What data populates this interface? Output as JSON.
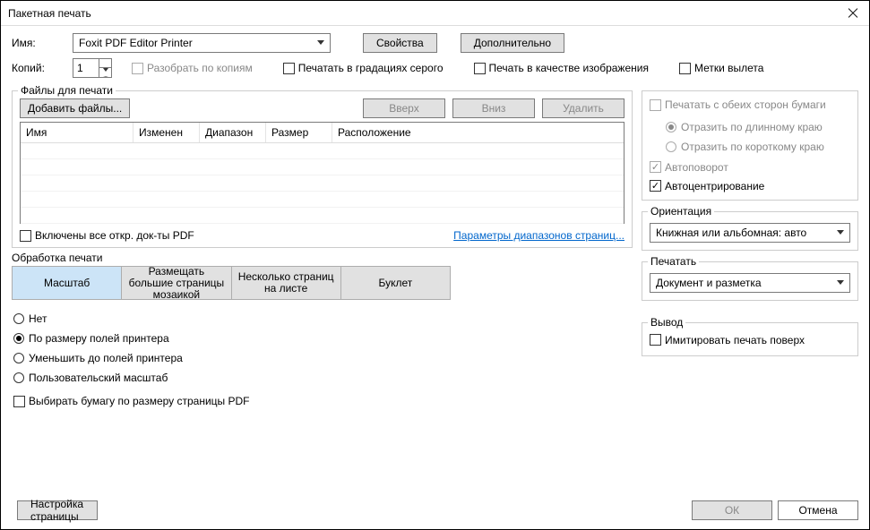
{
  "window": {
    "title": "Пакетная печать"
  },
  "printer": {
    "name_label": "Имя:",
    "name_value": "Foxit PDF Editor Printer",
    "properties_btn": "Свойства",
    "advanced_btn": "Дополнительно",
    "copies_label": "Копий:",
    "copies_value": "1",
    "collate": "Разобрать по копиям",
    "grayscale": "Печатать в градациях серого",
    "as_image": "Печать в качестве изображения",
    "bleed_marks": "Метки вылета"
  },
  "files": {
    "legend": "Файлы для печати",
    "add_btn": "Добавить файлы...",
    "up_btn": "Вверх",
    "down_btn": "Вниз",
    "delete_btn": "Удалить",
    "cols": {
      "name": "Имя",
      "modified": "Изменен",
      "range": "Диапазон",
      "size": "Размер",
      "location": "Расположение"
    },
    "include_open": "Включены все откр. док-ты PDF",
    "range_link": "Параметры диапазонов страниц..."
  },
  "handling": {
    "legend": "Обработка печати",
    "tabs": {
      "scale": "Масштаб",
      "tile": "Размещать большие страницы мозаикой",
      "multi": "Несколько страниц на листе",
      "booklet": "Буклет"
    },
    "radios": {
      "none": "Нет",
      "fit": "По размеру полей принтера",
      "shrink": "Уменьшить до полей принтера",
      "custom": "Пользовательский масштаб"
    },
    "choose_paper": "Выбирать бумагу по размеру страницы PDF"
  },
  "duplex": {
    "both_sides": "Печатать с обеих сторон бумаги",
    "flip_long": "Отразить по длинному краю",
    "flip_short": "Отразить по короткому краю",
    "auto_rotate": "Автоповорот",
    "auto_center": "Автоцентрирование"
  },
  "orientation": {
    "legend": "Ориентация",
    "value": "Книжная или альбомная: авто"
  },
  "print_what": {
    "legend": "Печатать",
    "value": "Документ и разметка"
  },
  "output": {
    "legend": "Вывод",
    "simulate": "Имитировать печать поверх"
  },
  "footer": {
    "page_setup": "Настройка страницы",
    "ok": "ОК",
    "cancel": "Отмена"
  }
}
